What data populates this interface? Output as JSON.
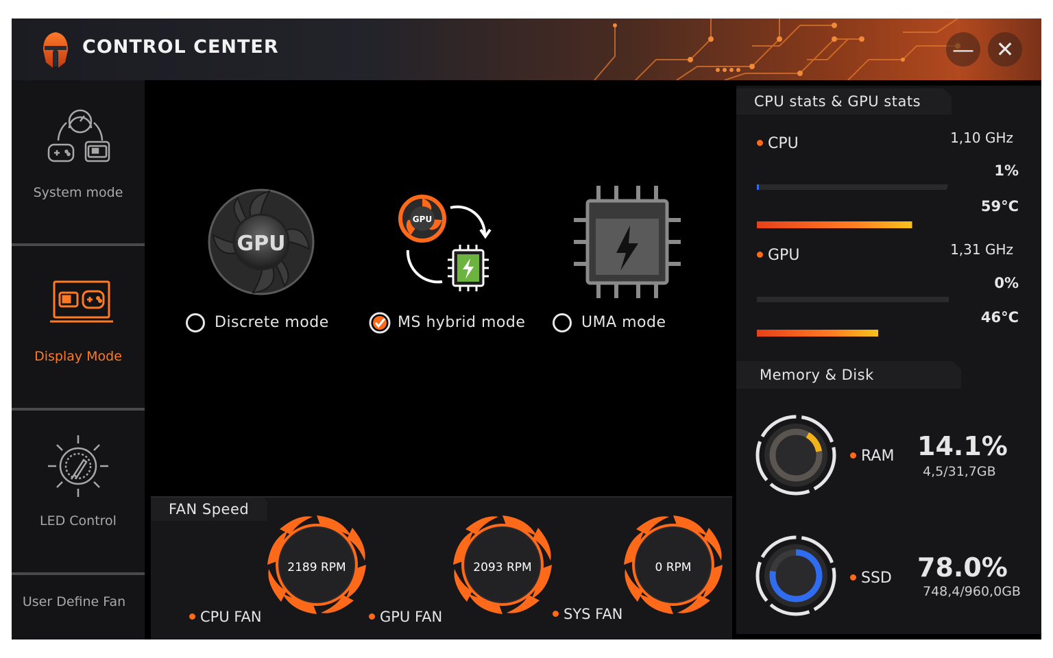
{
  "window": {
    "title": "CONTROL CENTER",
    "minimize_symbol": "—",
    "close_symbol": "✕"
  },
  "sidebar": {
    "items": [
      {
        "label": "System mode",
        "icon": "system-mode-icon",
        "active": false
      },
      {
        "label": "Display Mode",
        "icon": "display-mode-icon",
        "active": true
      },
      {
        "label": "LED Control",
        "icon": "led-control-icon",
        "active": false
      },
      {
        "label": "User Define Fan",
        "icon": "",
        "active": false
      }
    ]
  },
  "display_modes": [
    {
      "label": "Discrete mode",
      "icon_text": "GPU",
      "selected": false
    },
    {
      "label": "MS hybrid mode",
      "icon_text": "GPU",
      "selected": true
    },
    {
      "label": "UMA mode",
      "icon_text": "",
      "selected": false
    }
  ],
  "fan_speed": {
    "title": "FAN Speed",
    "fans": [
      {
        "label": "CPU FAN",
        "rpm": "2189 RPM"
      },
      {
        "label": "GPU FAN",
        "rpm": "2093 RPM"
      },
      {
        "label": "SYS FAN",
        "rpm": "0 RPM"
      }
    ]
  },
  "stats": {
    "title": "CPU stats & GPU stats",
    "cpu": {
      "label": "CPU",
      "clock": "1,10 GHz",
      "usage": "1%",
      "usage_fraction": 0.01,
      "temp": "59°C",
      "temp_fraction": 0.59
    },
    "gpu": {
      "label": "GPU",
      "clock": "1,31 GHz",
      "usage": "0%",
      "usage_fraction": 0.0,
      "temp": "46°C",
      "temp_fraction": 0.46
    }
  },
  "memory_disk": {
    "title": "Memory & Disk",
    "ram": {
      "label": "RAM",
      "percent": "14.1%",
      "detail": "4,5/31,7GB",
      "fraction": 0.141
    },
    "ssd": {
      "label": "SSD",
      "percent": "78.0%",
      "detail": "748,4/960,0GB",
      "fraction": 0.78
    }
  },
  "colors": {
    "accent": "#ff6a1a",
    "active_sidebar": "#ff7a22",
    "ram_ring": "#f2b21b",
    "ssd_ring": "#2f6cf0",
    "hybrid_chip": "#6db33f"
  }
}
